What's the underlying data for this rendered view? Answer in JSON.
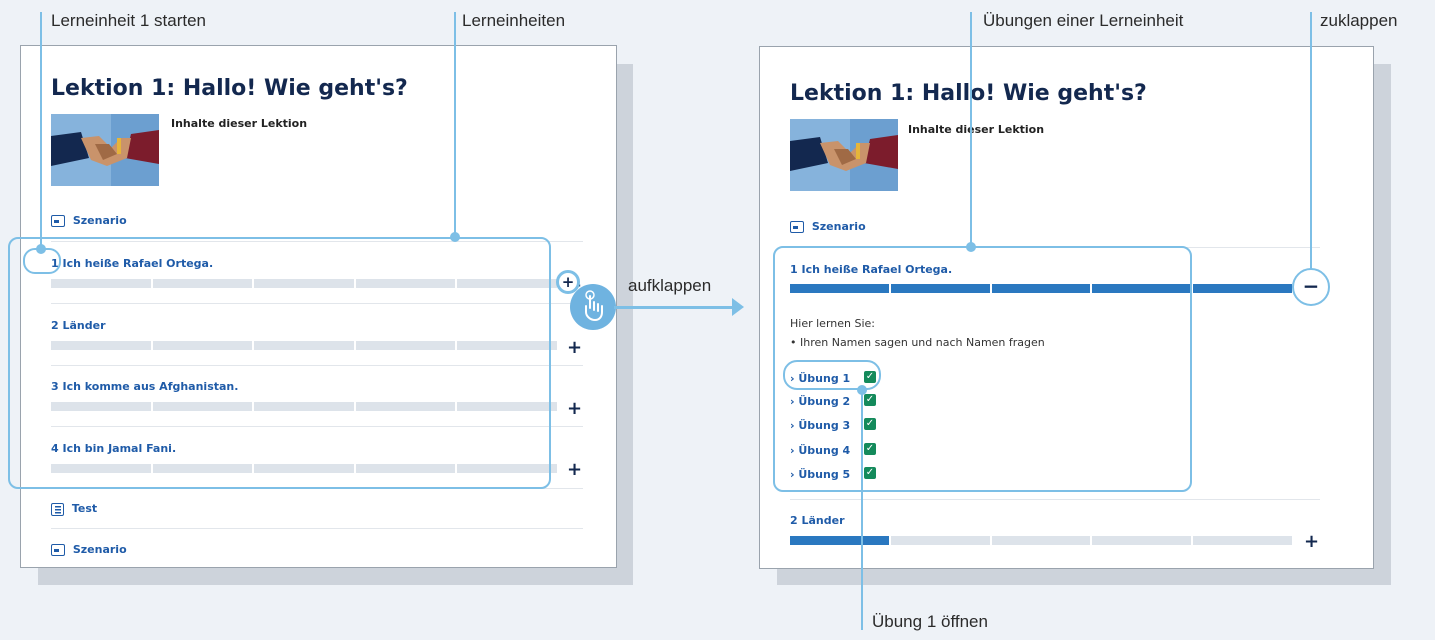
{
  "callouts": {
    "start_unit": "Lerneinheit 1 starten",
    "units": "Lerneinheiten",
    "expand": "aufklappen",
    "exercises": "Übungen einer Lerneinheit",
    "collapse": "zuklappen",
    "open_exercise": "Übung 1 öffnen"
  },
  "left_panel": {
    "title": "Lektion 1: Hallo! Wie geht's?",
    "contents_label": "Inhalte dieser Lektion",
    "scenario_top": "Szenario",
    "units": [
      {
        "label": "1 Ich heiße Rafael Ortega."
      },
      {
        "label": "2 Länder"
      },
      {
        "label": "3 Ich komme aus Afghanistan."
      },
      {
        "label": "4 Ich bin Jamal Fani."
      }
    ],
    "test": "Test",
    "scenario_bottom": "Szenario",
    "expand_symbol": "+"
  },
  "right_panel": {
    "title": "Lektion 1: Hallo! Wie geht's?",
    "contents_label": "Inhalte dieser Lektion",
    "scenario": "Szenario",
    "unit1": {
      "label": "1 Ich heiße Rafael Ortega.",
      "progress": 1.0,
      "learn_intro": "Hier lernen Sie:",
      "learn_point": "• Ihren Namen sagen und nach Namen fragen",
      "exercises": [
        "› Übung 1",
        "› Übung 2",
        "› Übung 3",
        "› Übung 4",
        "› Übung 5"
      ],
      "collapse_symbol": "−"
    },
    "unit2": {
      "label": "2 Länder",
      "progress": 0.2
    },
    "expand_symbol": "+"
  },
  "colors": {
    "accent": "#2a78c0",
    "highlight": "#7dbfe6",
    "check": "#148a5b",
    "title": "#13284f"
  }
}
